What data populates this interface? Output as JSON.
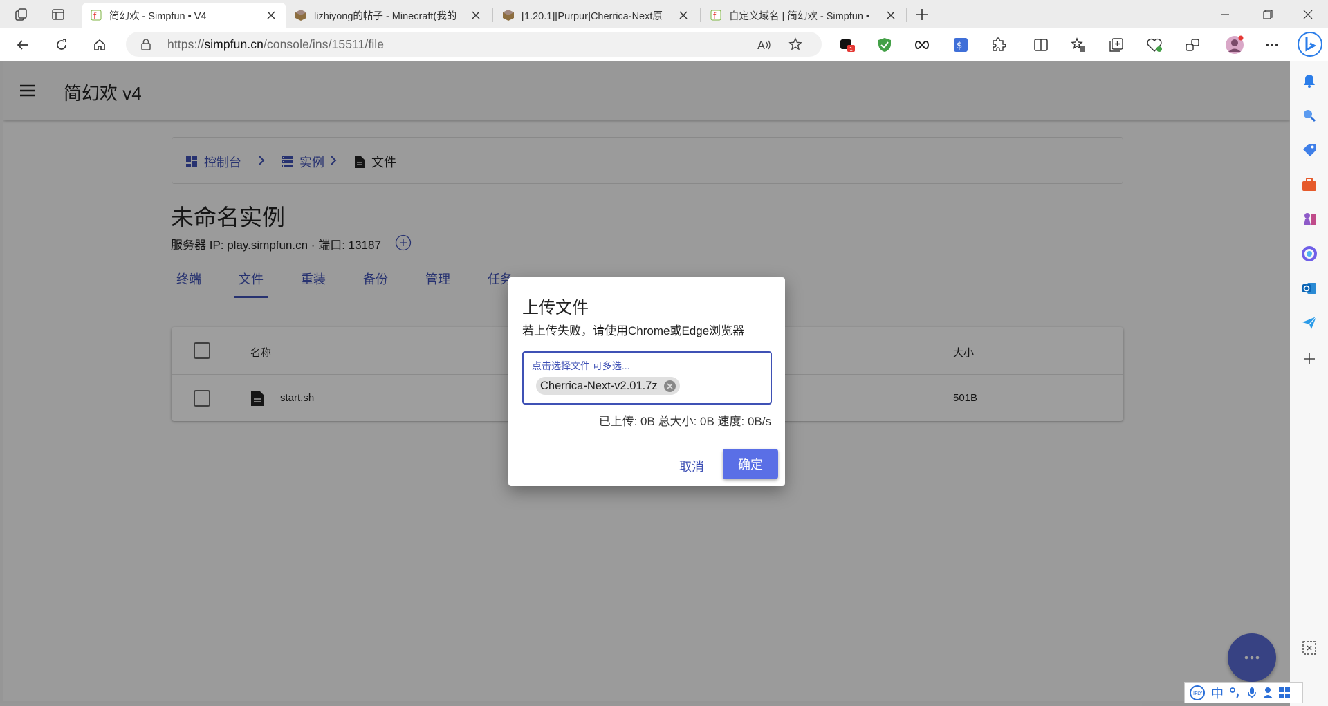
{
  "browser": {
    "tabs": [
      {
        "title": "简幻欢 - Simpfun • V4",
        "active": true
      },
      {
        "title": "lizhiyong的帖子 - Minecraft(我的",
        "active": false
      },
      {
        "title": "[1.20.1][Purpur]Cherrica-Next原",
        "active": false
      },
      {
        "title": "自定义域名 | 简幻欢 - Simpfun • ",
        "active": false
      }
    ],
    "url_prefix": "https://",
    "url_host": "simpfun.cn",
    "url_path": "/console/ins/15511/file"
  },
  "app": {
    "title": "简幻欢 v4",
    "breadcrumb": [
      {
        "label": "控制台",
        "icon": "dashboard-icon"
      },
      {
        "label": "实例",
        "icon": "storage-icon"
      },
      {
        "label": "文件",
        "icon": "file-icon"
      }
    ],
    "instance_name": "未命名实例",
    "server_line": "服务器 IP: play.simpfun.cn · 端口: 13187",
    "tabs": [
      "终端",
      "文件",
      "重装",
      "备份",
      "管理",
      "任务"
    ],
    "active_tab": "文件",
    "table": {
      "columns": {
        "name": "名称",
        "size": "大小"
      },
      "rows": [
        {
          "name": "start.sh",
          "size": "501B"
        }
      ]
    }
  },
  "dialog": {
    "title": "上传文件",
    "description": "若上传失败，请使用Chrome或Edge浏览器",
    "file_field_label": "点击选择文件 可多选...",
    "selected_file": "Cherrica-Next-v2.01.7z",
    "progress": "已上传: 0B 总大小: 0B 速度: 0B/s",
    "cancel": "取消",
    "confirm": "确定"
  },
  "ime": {
    "lang": "中"
  },
  "colors": {
    "primary": "#3f51b5",
    "confirm_button": "#5a6fe6",
    "fab": "#5a6bd4"
  }
}
